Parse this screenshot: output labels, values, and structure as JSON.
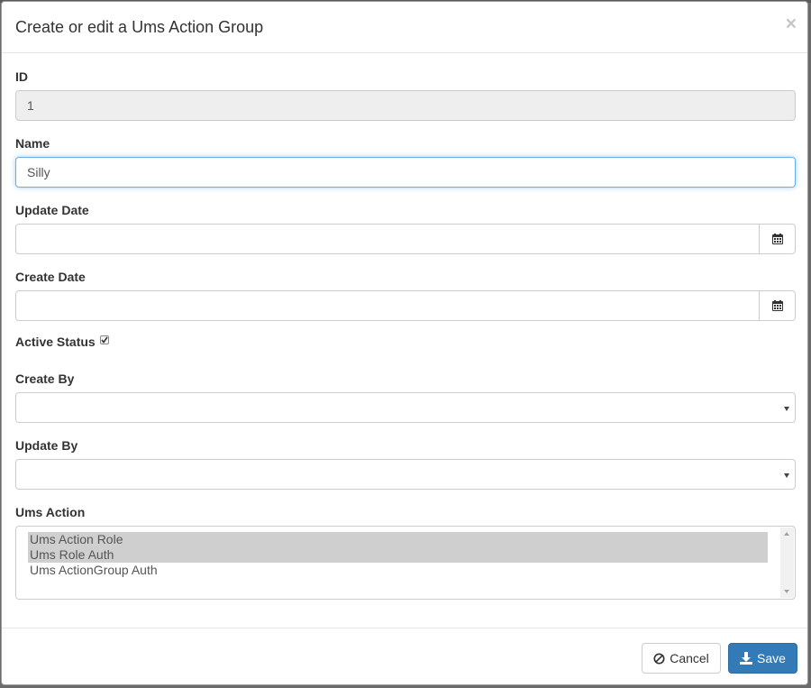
{
  "dialog": {
    "title": "Create or edit a Ums Action Group",
    "close_label": "×"
  },
  "fields": {
    "id": {
      "label": "ID",
      "value": "1"
    },
    "name": {
      "label": "Name",
      "value": "Silly"
    },
    "update_date": {
      "label": "Update Date",
      "value": ""
    },
    "create_date": {
      "label": "Create Date",
      "value": ""
    },
    "active_status": {
      "label": "Active Status",
      "checked": true
    },
    "create_by": {
      "label": "Create By",
      "selected": ""
    },
    "update_by": {
      "label": "Update By",
      "selected": ""
    },
    "ums_action": {
      "label": "Ums Action",
      "options": [
        {
          "label": "Ums Action Role",
          "selected": true
        },
        {
          "label": "Ums Role Auth",
          "selected": true
        },
        {
          "label": "Ums ActionGroup Auth",
          "selected": false
        }
      ]
    }
  },
  "footer": {
    "cancel_label": "Cancel",
    "save_label": "Save"
  },
  "colors": {
    "primary": "#337ab7",
    "focus_border": "#66afe9",
    "readonly_bg": "#eeeeee",
    "selected_option_bg": "#cfcfcf"
  },
  "icons": {
    "close": "close-icon",
    "calendar": "calendar-icon",
    "cancel": "ban-icon",
    "save": "download-icon",
    "checkbox": "checkbox-checked-icon",
    "dropdown": "caret-down-icon"
  }
}
